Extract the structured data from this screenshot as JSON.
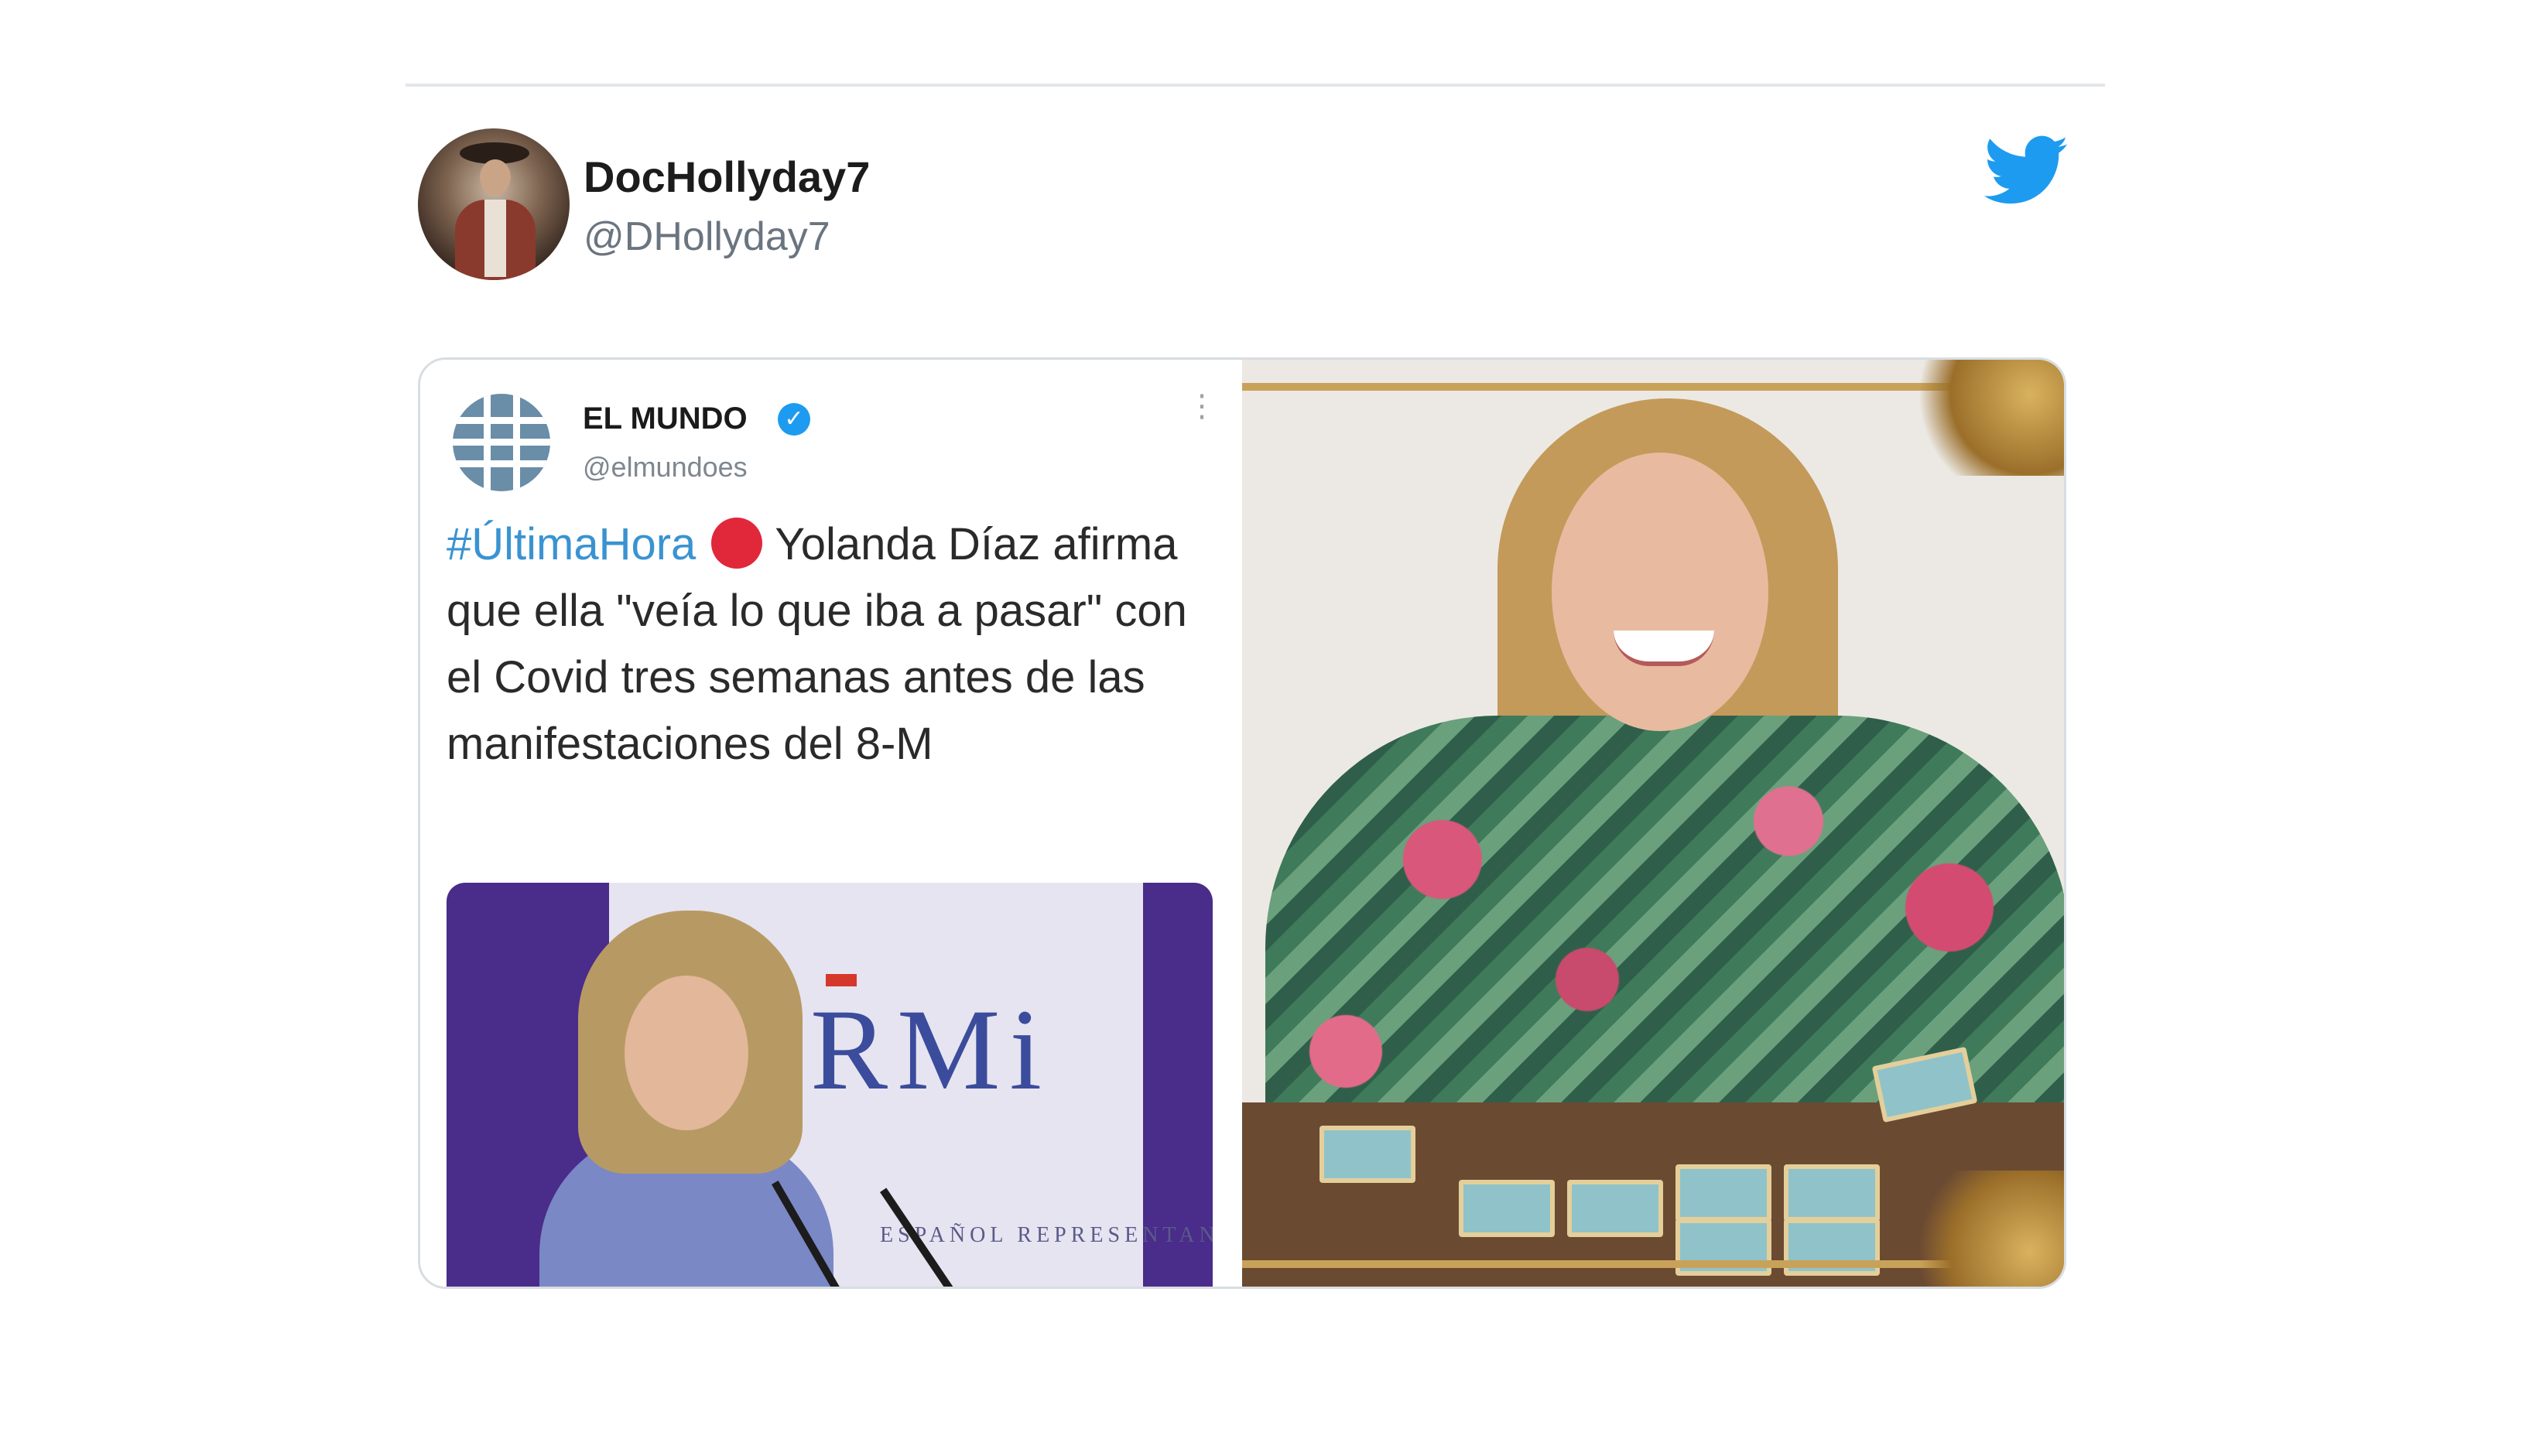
{
  "tweet": {
    "display_name": "DocHollyday7",
    "handle": "@DHollyday7",
    "avatar_icon": "user-avatar",
    "logo_icon": "twitter-bird-icon",
    "brand_color": "#1d9bf0"
  },
  "quoted_tweet": {
    "name": "EL MUNDO",
    "handle": "@elmundoes",
    "verified_icon": "verified-badge-icon",
    "more_icon": "more-options-icon",
    "hashtag": "#ÚltimaHora",
    "alert_icon": "red-circle-icon",
    "text": "Yolanda Díaz afirma que ella \"veía lo que iba a pasar\" con el Covid tres semanas antes de las manifestaciones del 8-M",
    "photo_banner_text": "RMi",
    "photo_banner_sub": "ESPAÑOL REPRESENTANTES",
    "hashtag_color": "#3a93d1",
    "alert_color": "#e0283a"
  }
}
